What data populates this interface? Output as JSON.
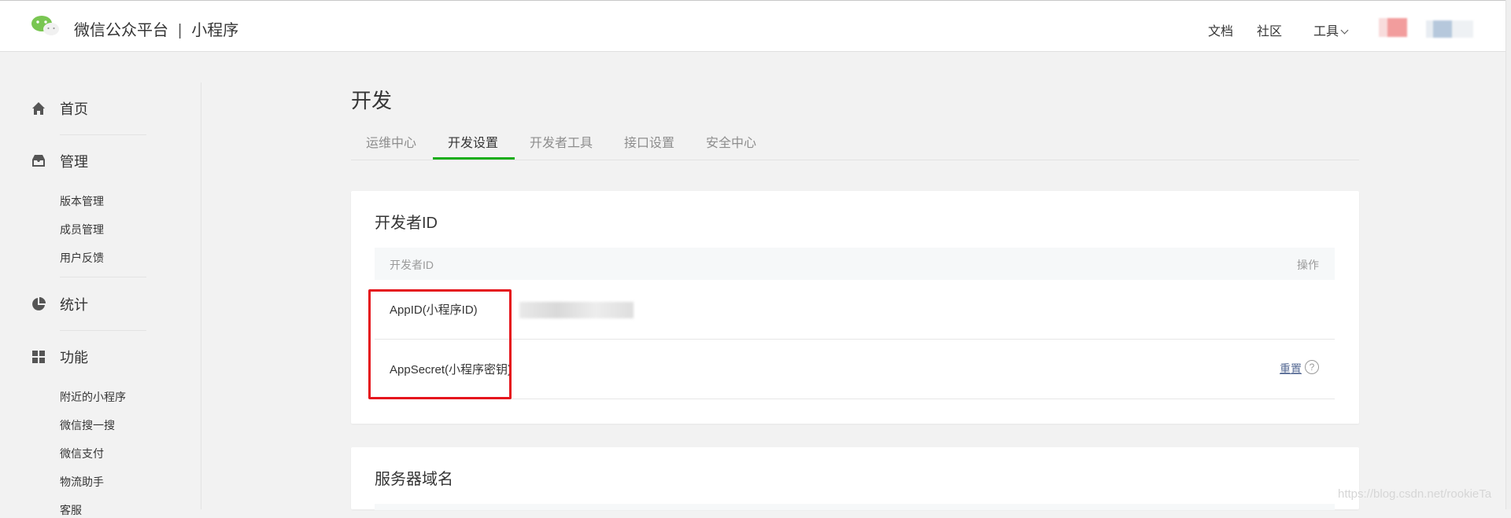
{
  "header": {
    "platform_name": "微信公众平台",
    "separator": "|",
    "product_name": "小程序",
    "nav": [
      {
        "label": "文档"
      },
      {
        "label": "社区"
      },
      {
        "label": "工具"
      }
    ]
  },
  "sidebar": {
    "sections": [
      {
        "label": "首页",
        "icon": "home-icon"
      },
      {
        "label": "管理",
        "icon": "inbox-icon",
        "items": [
          "版本管理",
          "成员管理",
          "用户反馈"
        ]
      },
      {
        "label": "统计",
        "icon": "pie-chart-icon"
      },
      {
        "label": "功能",
        "icon": "grid-icon",
        "items": [
          "附近的小程序",
          "微信搜一搜",
          "微信支付",
          "物流助手",
          "客服"
        ]
      }
    ]
  },
  "main": {
    "title": "开发",
    "tabs": [
      {
        "label": "运维中心"
      },
      {
        "label": "开发设置",
        "active": true
      },
      {
        "label": "开发者工具"
      },
      {
        "label": "接口设置"
      },
      {
        "label": "安全中心"
      }
    ],
    "developer_card": {
      "title": "开发者ID",
      "columns": [
        "开发者ID",
        "操作"
      ],
      "rows": [
        {
          "label": "AppID(小程序ID)"
        },
        {
          "label": "AppSecret(小程序密钥)",
          "action": "重置",
          "help": "?"
        }
      ]
    },
    "server_card": {
      "title": "服务器域名"
    }
  },
  "watermark": "https://blog.csdn.net/rookieTa",
  "colors": {
    "accent": "#1aad19",
    "link": "#576b95",
    "highlight": "#e5141c"
  }
}
